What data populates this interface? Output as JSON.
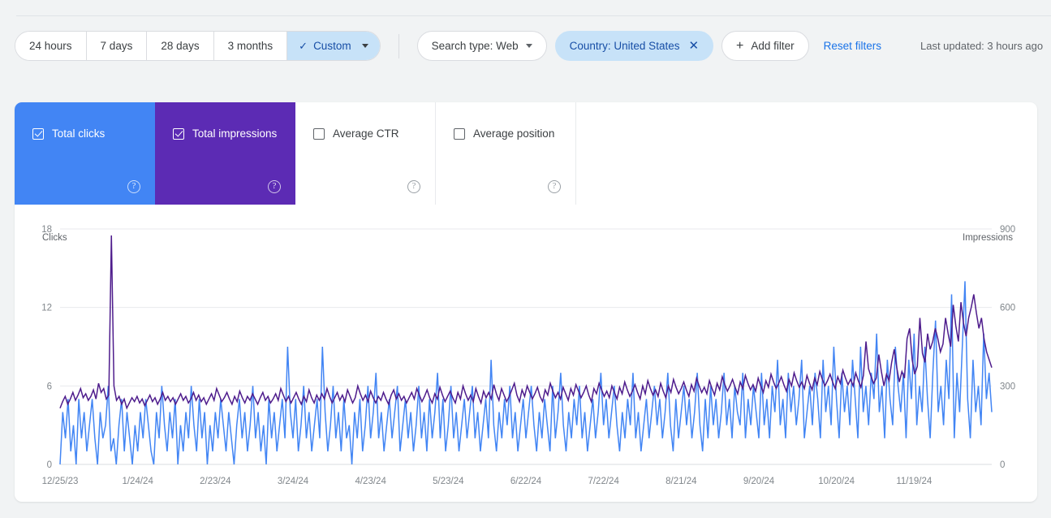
{
  "toolbar": {
    "date_ranges": [
      {
        "label": "24 hours",
        "active": false
      },
      {
        "label": "7 days",
        "active": false
      },
      {
        "label": "28 days",
        "active": false
      },
      {
        "label": "3 months",
        "active": false
      },
      {
        "label": "Custom",
        "active": true
      }
    ],
    "check_glyph": "✓",
    "search_type": {
      "label": "Search type: Web"
    },
    "country_filter": {
      "label": "Country: United States",
      "remove_glyph": "✕"
    },
    "add_filter": {
      "label": "Add filter",
      "plus_glyph": "+"
    },
    "reset_filters": {
      "label": "Reset filters"
    },
    "last_updated": "Last updated: 3 hours ago"
  },
  "metrics": [
    {
      "label": "Total clicks",
      "checked": true,
      "color": "#4285f4",
      "help_glyph": "?"
    },
    {
      "label": "Total impressions",
      "checked": true,
      "color": "#5c2bb4",
      "help_glyph": "?"
    },
    {
      "label": "Average CTR",
      "checked": false,
      "color": "#ffffff",
      "help_glyph": "?"
    },
    {
      "label": "Average position",
      "checked": false,
      "color": "#ffffff",
      "help_glyph": "?"
    }
  ],
  "colors": {
    "clicks": "#4285f4",
    "impressions": "#4e1c8c",
    "accent": "#1a73e8",
    "chip_selected_bg": "#c7e2f8",
    "page_bg": "#f1f3f4"
  },
  "chart_data": {
    "type": "line",
    "title": "",
    "xlabel": "",
    "ylabel": "Clicks",
    "y2label": "Impressions",
    "grid": true,
    "legend": "none",
    "left_axis": {
      "label": "Clicks",
      "ticks": [
        0,
        6,
        12,
        18
      ],
      "ylim": [
        0,
        18
      ]
    },
    "right_axis": {
      "label": "Impressions",
      "ticks": [
        0,
        300,
        600,
        900
      ],
      "ylim": [
        0,
        900
      ]
    },
    "x_tick_labels": [
      "12/25/23",
      "1/24/24",
      "2/23/24",
      "3/24/24",
      "4/23/24",
      "5/23/24",
      "6/22/24",
      "7/22/24",
      "8/21/24",
      "9/20/24",
      "10/20/24",
      "11/19/24"
    ],
    "x_tick_step_days": 30,
    "start_date": "12/25/23",
    "end_date": "12/19/24",
    "n_points": 361,
    "series": [
      {
        "name": "Total clicks",
        "axis": "left",
        "color": "#4285f4",
        "units": "clicks",
        "values": [
          0,
          4,
          2,
          5,
          1,
          3,
          0,
          5,
          2,
          4,
          1,
          3,
          5,
          2,
          0,
          4,
          2,
          3,
          6,
          1,
          2,
          0,
          3,
          5,
          1,
          4,
          2,
          0,
          3,
          1,
          4,
          2,
          5,
          3,
          1,
          0,
          4,
          2,
          6,
          3,
          1,
          4,
          2,
          5,
          0,
          3,
          1,
          4,
          2,
          6,
          3,
          1,
          5,
          2,
          4,
          0,
          3,
          1,
          4,
          2,
          5,
          3,
          1,
          4,
          2,
          0,
          3,
          5,
          2,
          4,
          1,
          3,
          6,
          2,
          4,
          1,
          3,
          0,
          5,
          2,
          4,
          1,
          3,
          5,
          2,
          9,
          4,
          2,
          5,
          1,
          3,
          6,
          2,
          4,
          1,
          3,
          5,
          2,
          9,
          4,
          1,
          3,
          6,
          2,
          4,
          1,
          5,
          2,
          3,
          0,
          4,
          2,
          5,
          1,
          3,
          6,
          2,
          4,
          7,
          2,
          4,
          1,
          3,
          5,
          2,
          4,
          6,
          1,
          3,
          5,
          2,
          4,
          1,
          3,
          6,
          2,
          4,
          1,
          5,
          2,
          4,
          7,
          2,
          5,
          1,
          3,
          6,
          2,
          4,
          1,
          3,
          5,
          2,
          4,
          6,
          2,
          4,
          1,
          3,
          5,
          2,
          8,
          3,
          1,
          4,
          2,
          5,
          3,
          6,
          2,
          4,
          1,
          3,
          5,
          2,
          4,
          6,
          3,
          1,
          4,
          2,
          5,
          3,
          1,
          6,
          2,
          4,
          7,
          3,
          1,
          4,
          2,
          5,
          3,
          6,
          2,
          4,
          1,
          3,
          5,
          2,
          4,
          7,
          3,
          5,
          2,
          4,
          6,
          3,
          1,
          4,
          2,
          5,
          3,
          7,
          2,
          4,
          1,
          3,
          5,
          2,
          4,
          6,
          3,
          5,
          2,
          4,
          7,
          3,
          1,
          5,
          2,
          4,
          6,
          3,
          5,
          2,
          4,
          7,
          3,
          1,
          5,
          2,
          6,
          3,
          5,
          2,
          4,
          7,
          3,
          5,
          2,
          6,
          4,
          3,
          7,
          2,
          5,
          3,
          6,
          4,
          2,
          7,
          3,
          5,
          2,
          6,
          4,
          8,
          3,
          5,
          2,
          7,
          4,
          6,
          3,
          5,
          8,
          2,
          4,
          6,
          3,
          7,
          5,
          2,
          8,
          4,
          6,
          3,
          9,
          5,
          2,
          7,
          4,
          6,
          3,
          8,
          5,
          2,
          9,
          4,
          6,
          3,
          7,
          5,
          10,
          4,
          6,
          2,
          8,
          5,
          3,
          9,
          6,
          4,
          7,
          2,
          8,
          5,
          10,
          3,
          6,
          4,
          9,
          5,
          2,
          7,
          11,
          4,
          6,
          3,
          8,
          5,
          13,
          2,
          7,
          4,
          9,
          14,
          5,
          2,
          8,
          4,
          6,
          3,
          10,
          5,
          7,
          4
        ]
      },
      {
        "name": "Total impressions",
        "axis": "right",
        "color": "#4e1c8c",
        "units": "impressions",
        "values": [
          215,
          240,
          260,
          230,
          250,
          275,
          245,
          265,
          290,
          255,
          270,
          245,
          260,
          285,
          250,
          310,
          275,
          290,
          250,
          265,
          875,
          300,
          245,
          260,
          230,
          250,
          215,
          235,
          255,
          240,
          260,
          235,
          250,
          225,
          245,
          265,
          240,
          255,
          230,
          250,
          275,
          245,
          260,
          240,
          255,
          230,
          250,
          270,
          245,
          260,
          235,
          250,
          275,
          245,
          265,
          240,
          255,
          230,
          250,
          270,
          245,
          290,
          265,
          240,
          255,
          275,
          250,
          230,
          260,
          240,
          280,
          255,
          235,
          260,
          245,
          270,
          250,
          230,
          255,
          275,
          245,
          260,
          235,
          250,
          270,
          245,
          290,
          265,
          240,
          260,
          235,
          255,
          275,
          250,
          230,
          260,
          240,
          285,
          255,
          235,
          265,
          245,
          270,
          250,
          290,
          260,
          235,
          255,
          275,
          245,
          265,
          240,
          285,
          260,
          235,
          255,
          300,
          270,
          245,
          265,
          240,
          280,
          255,
          235,
          260,
          245,
          275,
          250,
          230,
          265,
          285,
          250,
          270,
          245,
          260,
          235,
          255,
          275,
          250,
          290,
          265,
          240,
          260,
          285,
          255,
          235,
          270,
          250,
          295,
          265,
          240,
          260,
          280,
          255,
          235,
          275,
          250,
          300,
          270,
          245,
          265,
          240,
          290,
          260,
          235,
          280,
          255,
          275,
          250,
          305,
          270,
          245,
          290,
          265,
          240,
          260,
          285,
          310,
          265,
          240,
          285,
          260,
          300,
          275,
          250,
          270,
          295,
          260,
          240,
          285,
          265,
          310,
          280,
          255,
          275,
          250,
          295,
          270,
          245,
          290,
          265,
          305,
          280,
          255,
          275,
          300,
          265,
          240,
          290,
          270,
          310,
          285,
          260,
          280,
          255,
          300,
          275,
          250,
          295,
          270,
          315,
          285,
          260,
          280,
          305,
          275,
          250,
          300,
          270,
          320,
          290,
          265,
          285,
          260,
          310,
          280,
          255,
          300,
          275,
          325,
          295,
          270,
          290,
          315,
          285,
          260,
          305,
          280,
          330,
          300,
          275,
          295,
          270,
          320,
          290,
          265,
          310,
          285,
          335,
          305,
          280,
          300,
          325,
          295,
          270,
          315,
          290,
          340,
          310,
          285,
          305,
          280,
          330,
          300,
          275,
          320,
          295,
          345,
          315,
          290,
          310,
          335,
          305,
          280,
          325,
          300,
          350,
          320,
          295,
          315,
          290,
          340,
          310,
          285,
          330,
          305,
          355,
          325,
          300,
          320,
          345,
          315,
          290,
          335,
          310,
          360,
          330,
          305,
          325,
          300,
          350,
          320,
          295,
          340,
          470,
          365,
          335,
          310,
          330,
          420,
          355,
          300,
          345,
          320,
          390,
          440,
          370,
          315,
          355,
          330,
          480,
          520,
          400,
          345,
          375,
          560,
          425,
          390,
          500,
          440,
          470,
          520,
          480,
          430,
          460,
          560,
          500,
          450,
          610,
          530,
          470,
          620,
          540,
          490,
          560,
          600,
          650,
          580,
          520,
          560,
          480,
          430,
          400,
          370
        ]
      }
    ]
  }
}
